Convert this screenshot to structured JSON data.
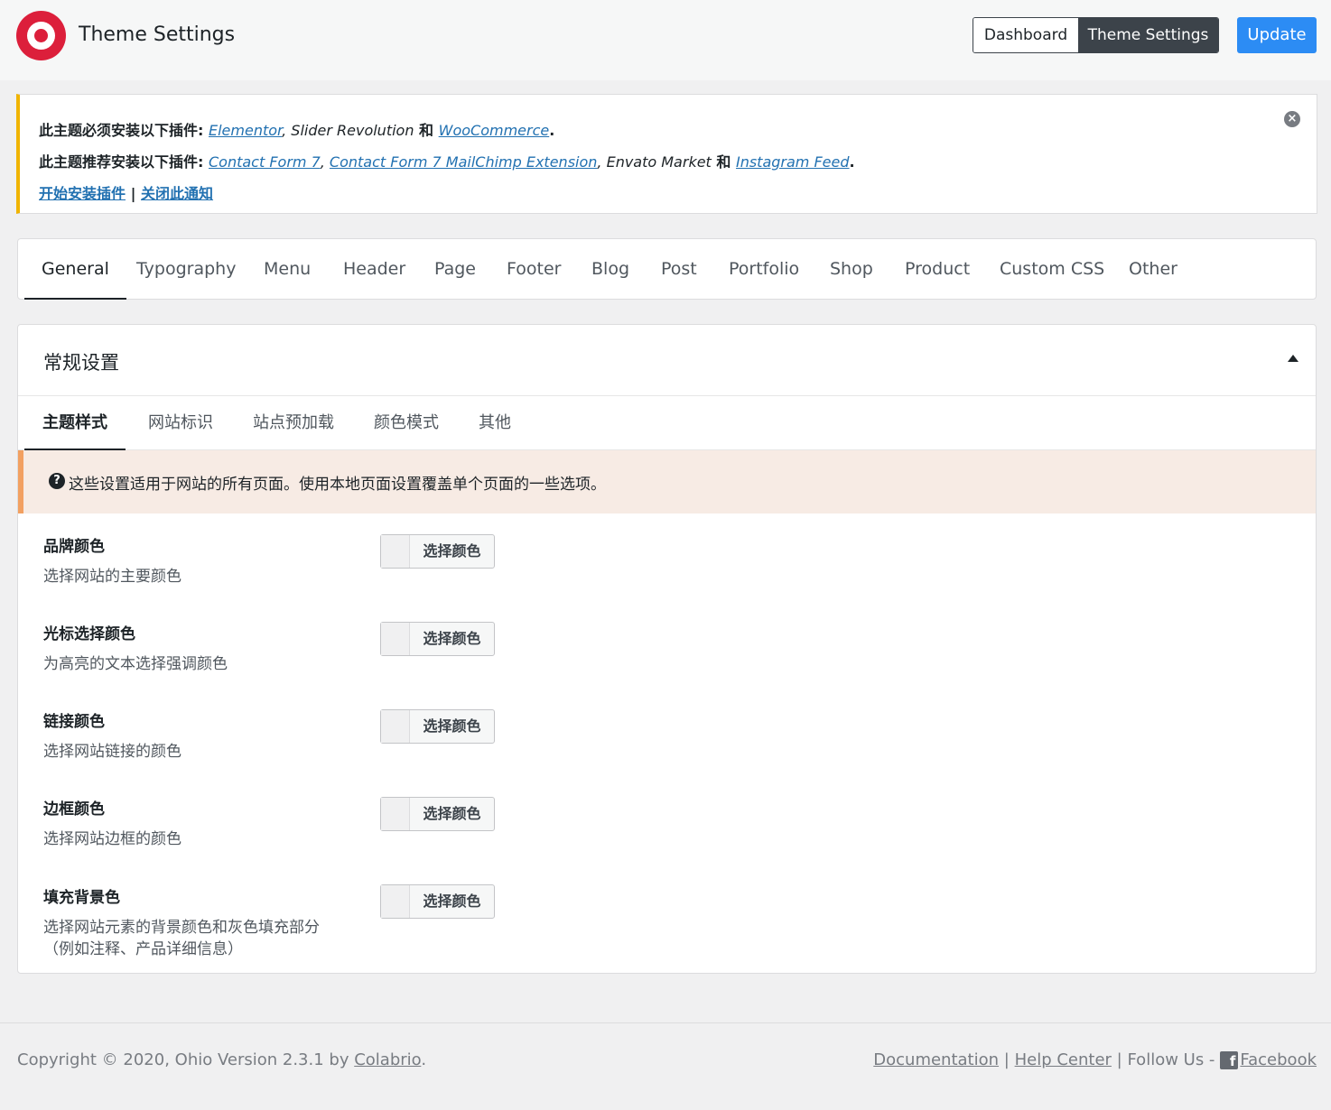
{
  "app": {
    "title": "Theme Settings"
  },
  "header": {
    "nav": [
      {
        "label": "Dashboard"
      },
      {
        "label": "Theme Settings"
      }
    ],
    "update_label": "Update"
  },
  "notice": {
    "required_prefix": "此主题必须安装以下插件",
    "required_plugins": {
      "p1": "Elementor",
      "sep1": ", ",
      "p2": "Slider Revolution",
      "and": " 和 ",
      "p3": "WooCommerce",
      "end": "."
    },
    "recommended_prefix": "此主题推荐安装以下插件",
    "recommended_plugins": {
      "p1": "Contact Form 7",
      "sep1": ", ",
      "p2": "Contact Form 7 MailChimp Extension",
      "sep2": ", ",
      "p3": "Envato Market",
      "and": " 和 ",
      "p4": "Instagram Feed",
      "end": "."
    },
    "install_link": "开始安装插件",
    "separator": "|",
    "dismiss_link": "关闭此通知",
    "dismiss_icon": "close-circle-icon"
  },
  "tabs": [
    {
      "label": "General",
      "active": true
    },
    {
      "label": "Typography"
    },
    {
      "label": "Menu"
    },
    {
      "label": "Header"
    },
    {
      "label": "Page"
    },
    {
      "label": "Footer"
    },
    {
      "label": "Blog"
    },
    {
      "label": "Post"
    },
    {
      "label": "Portfolio"
    },
    {
      "label": "Shop"
    },
    {
      "label": "Product"
    },
    {
      "label": "Custom CSS"
    },
    {
      "label": "Other"
    }
  ],
  "panel": {
    "title": "常规设置",
    "subtabs": [
      {
        "label": "主题样式",
        "active": true
      },
      {
        "label": "网站标识"
      },
      {
        "label": "站点预加载"
      },
      {
        "label": "颜色模式"
      },
      {
        "label": "其他"
      }
    ],
    "info_icon": "question-circle-icon",
    "info_text": "这些设置适用于网站的所有页面。使用本地页面设置覆盖单个页面的一些选项。",
    "settings": [
      {
        "label": "品牌颜色",
        "desc": "选择网站的主要颜色",
        "button": "选择颜色"
      },
      {
        "label": "光标选择颜色",
        "desc": "为高亮的文本选择强调颜色",
        "button": "选择颜色"
      },
      {
        "label": "链接颜色",
        "desc": "选择网站链接的颜色",
        "button": "选择颜色"
      },
      {
        "label": "边框颜色",
        "desc": "选择网站边框的颜色",
        "button": "选择颜色"
      },
      {
        "label": "填充背景色",
        "desc": "选择网站元素的背景颜色和灰色填充部分（例如注释、产品详细信息）",
        "button": "选择颜色"
      }
    ]
  },
  "footer": {
    "copyright_prefix": "Copyright © 2020, Ohio Version 2.3.1 by ",
    "author_link": "Colabrio",
    "copyright_suffix": ".",
    "documentation": "Documentation",
    "help_center": "Help Center",
    "follow_us": "Follow Us -",
    "sep": "|",
    "facebook": "Facebook",
    "facebook_icon_glyph": "f"
  },
  "colors": {
    "accent": "#2c8cf4",
    "brand": "#dc1f3b",
    "notice_border": "#f0b400",
    "info_border": "#f2a061",
    "info_bg": "#f7ebe4"
  }
}
